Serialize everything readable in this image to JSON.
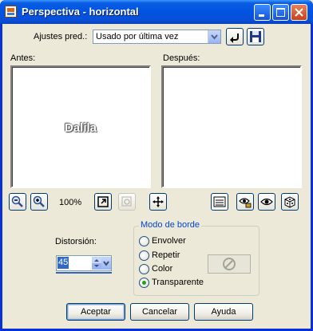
{
  "window": {
    "title": "Perspectiva - horizontal"
  },
  "presets": {
    "label": "Ajustes pred.:",
    "value": "Usado por última vez"
  },
  "previews": {
    "before_label": "Antes:",
    "after_label": "Después:",
    "before_text": "Dalila"
  },
  "zoom": {
    "level": "100%"
  },
  "distortion": {
    "label": "Distorsión:",
    "value": "45"
  },
  "border_mode": {
    "title": "Modo de borde",
    "options": [
      {
        "label": "Envolver",
        "checked": false
      },
      {
        "label": "Repetir",
        "checked": false
      },
      {
        "label": "Color",
        "checked": false
      },
      {
        "label": "Transparente",
        "checked": true
      }
    ]
  },
  "buttons": {
    "ok": "Aceptar",
    "cancel": "Cancelar",
    "help": "Ayuda"
  }
}
